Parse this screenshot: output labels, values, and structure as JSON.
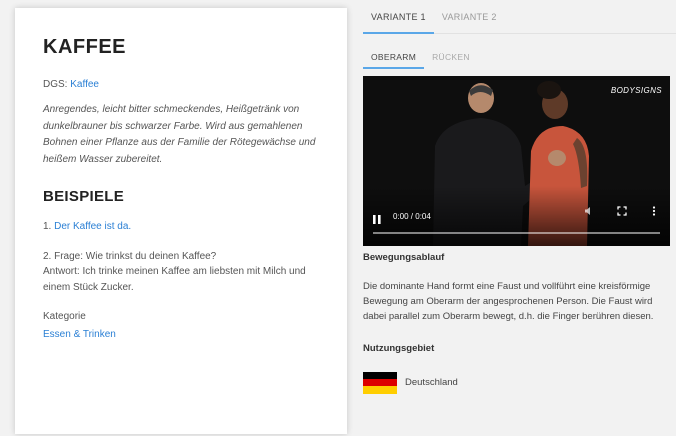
{
  "entry": {
    "title": "KAFFEE",
    "dgs_label": "DGS:",
    "dgs_link": "Kaffee",
    "description": "Anregendes, leicht bitter schmeckendes, Heißgetränk von dunkelbrauner bis schwarzer Farbe. Wird aus gemahlenen Bohnen einer Pflanze aus der Familie der Rötegewächse und heißem Wasser zubereitet.",
    "examples_heading": "BEISPIELE",
    "example1_prefix": "1.",
    "example1_link": "Der Kaffee ist da.",
    "example2_question": "2. Frage: Wie trinkst du deinen Kaffee?",
    "example2_answer": "Antwort: Ich trinke meinen Kaffee am liebsten mit Milch und einem Stück Zucker.",
    "category_label": "Kategorie",
    "category_link": "Essen & Trinken"
  },
  "tabs": [
    "VARIANTE 1",
    "VARIANTE 2"
  ],
  "subtabs": [
    "OBERARM",
    "RÜCKEN"
  ],
  "video": {
    "logo": "BODYSIGNS",
    "time": "0:00 / 0:04",
    "play_icon": "pause-icon",
    "progress": 0
  },
  "movement": {
    "heading": "Bewegungsablauf",
    "text": "Die dominante Hand formt eine Faust und vollführt eine kreisförmige Bewegung am Oberarm der angesprochenen Person. Die Faust wird dabei parallel zum Oberarm bewegt, d.h. die Finger berühren diesen."
  },
  "usage": {
    "heading": "Nutzungsgebiet",
    "country": "Deutschland"
  },
  "colors": {
    "accent": "#5aa7e8",
    "link": "#2a7fd4"
  }
}
